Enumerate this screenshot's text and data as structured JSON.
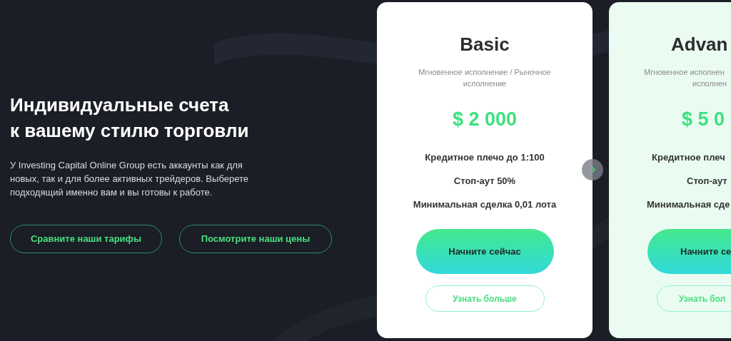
{
  "hero": {
    "headline_lines": [
      "Индивидуальные счета",
      "к вашему стилю торговли"
    ],
    "text_lines": [
      "У Investing Capital Online Group есть аккаунты как для",
      "новых, так и для более активных трейдеров. Выберете",
      "подходящий именно вам и вы готовы к работе."
    ],
    "buttons": [
      "Сравните наши тарифы",
      "Посмотрите наши цены"
    ]
  },
  "plans": [
    {
      "name": "Basic",
      "highlighted": false,
      "subtitle_lines": [
        "Мгновенное исполнение / Рыночное",
        "исполнение"
      ],
      "price": "$ 2 000",
      "features": [
        "Кредитное плечо до 1:100",
        "Стоп-аут 50%",
        "Минимальная сделка 0,01 лота"
      ],
      "primary_button": "Начните сейчас",
      "secondary_button": "Узнать больше"
    },
    {
      "name": "Advan",
      "highlighted": true,
      "subtitle_lines": [
        "Мгновенное исполнен",
        "исполнен"
      ],
      "price": "$ 5 0",
      "features": [
        "Кредитное плеч",
        "Стоп-аут",
        "Минимальная сде"
      ],
      "primary_button": "Начните се",
      "secondary_button": "Узнать бол"
    }
  ]
}
